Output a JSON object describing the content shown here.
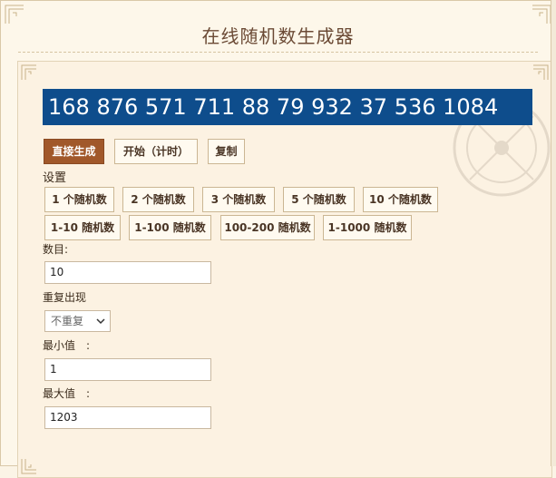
{
  "page": {
    "title": "在线随机数生成器"
  },
  "result": {
    "text": "168 876 571 711 88 79 932 37 536 1084"
  },
  "actions": {
    "generate": "直接生成",
    "start_timer": "开始（计时）",
    "copy": "复制"
  },
  "settings": {
    "label": "设置",
    "count_presets": [
      "1 个随机数",
      "2 个随机数",
      "3 个随机数",
      "5 个随机数",
      "10 个随机数"
    ],
    "range_presets": [
      "1-10 随机数",
      "1-100 随机数",
      "100-200 随机数",
      "1-1000 随机数"
    ]
  },
  "form": {
    "count_label": "数目:",
    "count_value": "10",
    "repeat_label": "重复出现",
    "repeat_value": "不重复",
    "min_label": "最小值　:",
    "min_value": "1",
    "max_label": "最大值　:",
    "max_value": "1203"
  },
  "colors": {
    "result_bg": "#0e4d8c",
    "primary_button": "#a1582a",
    "page_bg": "#fdf7ea"
  }
}
